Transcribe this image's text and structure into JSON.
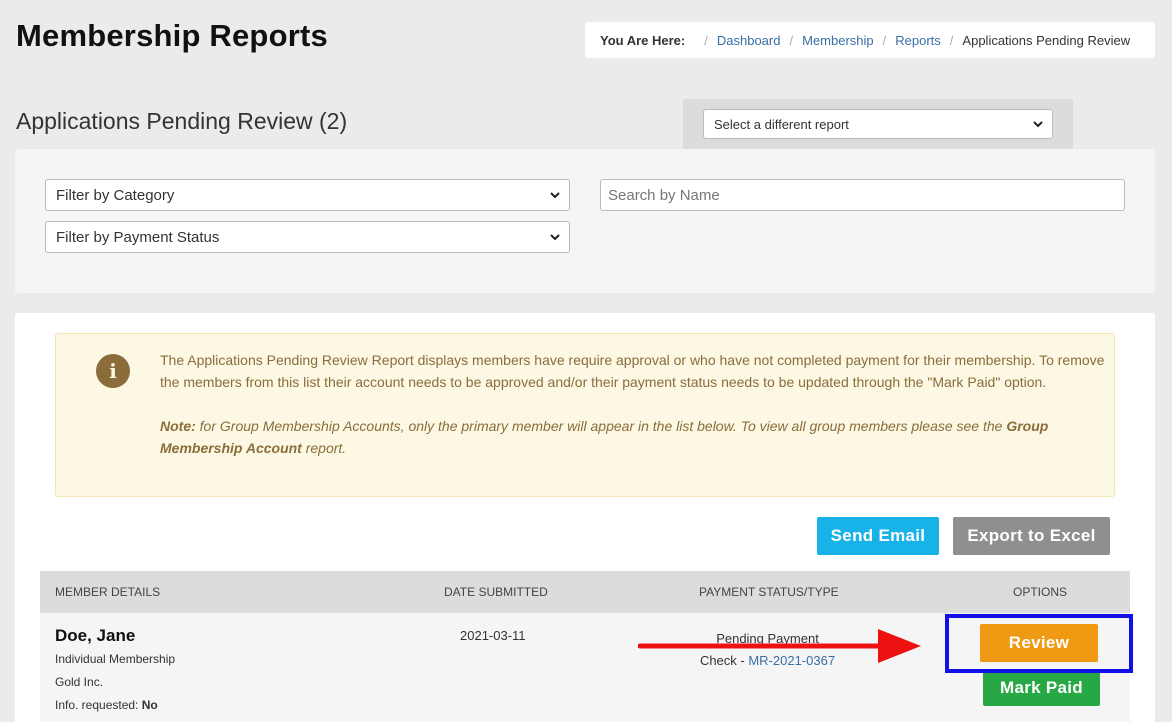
{
  "header": {
    "title": "Membership Reports"
  },
  "breadcrumb": {
    "label": "You Are Here:",
    "items": [
      "Dashboard",
      "Membership",
      "Reports"
    ],
    "current": "Applications Pending Review",
    "separator": "/"
  },
  "report": {
    "title": "Applications Pending Review (2)",
    "select_label": "Select a different report"
  },
  "filters": {
    "category": "Filter by Category",
    "payment_status": "Filter by Payment Status",
    "search_placeholder": "Search by Name"
  },
  "info": {
    "icon": "info-icon",
    "line1": "The Applications Pending Review Report displays members have require approval or who have not completed payment for their membership. To remove the members from this list their account needs to be approved and/or their payment status needs to be updated through the \"Mark Paid\" option.",
    "note_label": "Note:",
    "note_text": " for Group Membership Accounts, only the primary member will appear in the list below. To view all group members please see the ",
    "note_bold": "Group Membership Account",
    "note_end": " report."
  },
  "actions": {
    "send_email": "Send Email",
    "export_excel": "Export to Excel"
  },
  "table": {
    "headers": [
      "Member Details",
      "Date Submitted",
      "Payment Status/Type",
      "Options"
    ],
    "rows": [
      {
        "name": "Doe, Jane",
        "membership_type": "Individual Membership",
        "company": "Gold Inc.",
        "info_requested_label": "Info. requested:",
        "info_requested_value": "No",
        "date_submitted": "2021-03-11",
        "payment_status": "Pending Payment",
        "payment_type": "Check - ",
        "payment_ref": "MR-2021-0367",
        "review_label": "Review",
        "mark_paid_label": "Mark Paid"
      }
    ]
  },
  "colors": {
    "send_email": "#17b2e8",
    "export_excel": "#8f8f8f",
    "review": "#ef9a12",
    "mark_paid": "#27a844",
    "annotation_arrow": "#ee1111",
    "annotation_box": "#1210e6"
  }
}
